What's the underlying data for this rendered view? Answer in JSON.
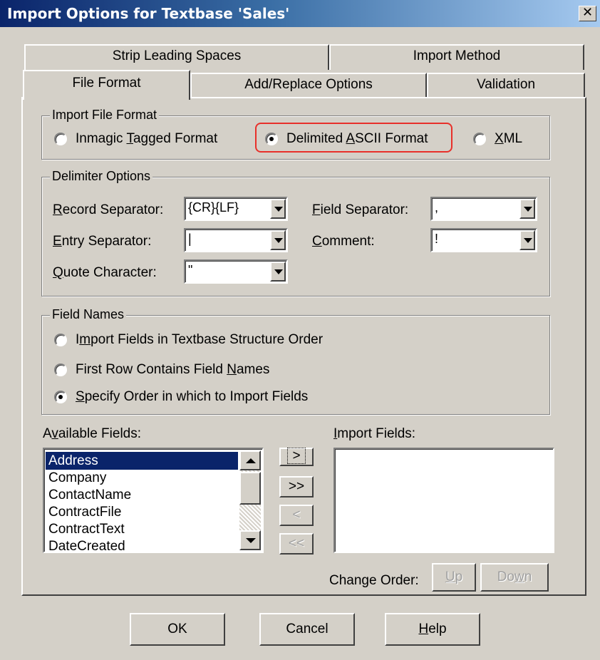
{
  "window": {
    "title": "Import Options for Textbase 'Sales'",
    "close_glyph": "✕"
  },
  "tabs": {
    "row1": [
      "Strip Leading Spaces",
      "Import Method"
    ],
    "row2": [
      "File Format",
      "Add/Replace Options",
      "Validation"
    ],
    "active": "File Format"
  },
  "import_file_format": {
    "legend": "Import File Format",
    "options": [
      {
        "label": "Inmagic Tagged Format",
        "mnemonic": "T",
        "selected": false
      },
      {
        "label": "Delimited ASCII Format",
        "mnemonic": "A",
        "selected": true
      },
      {
        "label": "XML",
        "mnemonic": "X",
        "selected": false
      }
    ]
  },
  "delimiter_options": {
    "legend": "Delimiter Options",
    "record_separator": {
      "label": "Record Separator:",
      "value": "{CR}{LF}"
    },
    "field_separator": {
      "label": "Field Separator:",
      "value": ","
    },
    "entry_separator": {
      "label": "Entry Separator:",
      "value": "|"
    },
    "comment": {
      "label": "Comment:",
      "value": "!"
    },
    "quote_character": {
      "label": "Quote Character:",
      "value": "\""
    }
  },
  "field_names": {
    "legend": "Field Names",
    "options": [
      {
        "label": "Import Fields in Textbase Structure Order",
        "selected": false
      },
      {
        "label": "First Row Contains Field Names",
        "selected": false
      },
      {
        "label": "Specify Order in which to Import Fields",
        "selected": true
      }
    ]
  },
  "available_fields": {
    "label": "Available Fields:",
    "items": [
      "Address",
      "Company",
      "ContactName",
      "ContractFile",
      "ContractText",
      "DateCreated"
    ],
    "selected": "Address"
  },
  "import_fields": {
    "label": "Import Fields:",
    "items": []
  },
  "move_buttons": [
    ">",
    ">>",
    "<",
    "<<"
  ],
  "change_order": {
    "label": "Change Order:",
    "up": "Up",
    "down": "Down"
  },
  "footer": {
    "ok": "OK",
    "cancel": "Cancel",
    "help": "Help"
  },
  "colors": {
    "titlebar": "#0a246a",
    "highlight_outline": "#e8302a",
    "selection": "#0a246a",
    "face": "#d4d0c8"
  }
}
